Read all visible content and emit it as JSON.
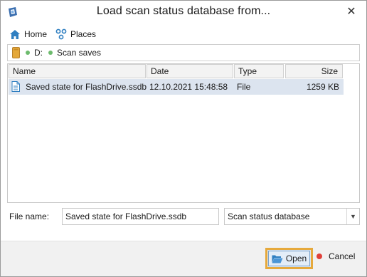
{
  "window": {
    "title": "Load scan status database from...",
    "close_glyph": "✕",
    "app_icon": "app-icon"
  },
  "nav": {
    "items": [
      {
        "label": "Home",
        "icon": "home-icon"
      },
      {
        "label": "Places",
        "icon": "places-icon"
      }
    ]
  },
  "path": {
    "icon": "drive-icon",
    "segments": [
      "D:",
      "Scan saves"
    ]
  },
  "file_list": {
    "columns": [
      "Name",
      "Date",
      "Type",
      "Size"
    ],
    "rows": [
      {
        "name": "Saved state for FlashDrive.ssdb",
        "date": "12.10.2021 15:48:58",
        "type": "File",
        "size": "1259 KB",
        "icon": "file-icon",
        "selected": true
      }
    ]
  },
  "file_name": {
    "label": "File name:",
    "value": "Saved state for FlashDrive.ssdb"
  },
  "file_type": {
    "selected": "Scan status database",
    "arrow_glyph": "▼"
  },
  "buttons": {
    "open_label": "Open",
    "cancel_label": "Cancel"
  },
  "colors": {
    "accent_focus": "#e6a93c",
    "selection": "#dce4ef",
    "path_dot": "#6dbb6d",
    "cancel_dot": "#e0413a",
    "icon_blue": "#2f7fc1"
  }
}
